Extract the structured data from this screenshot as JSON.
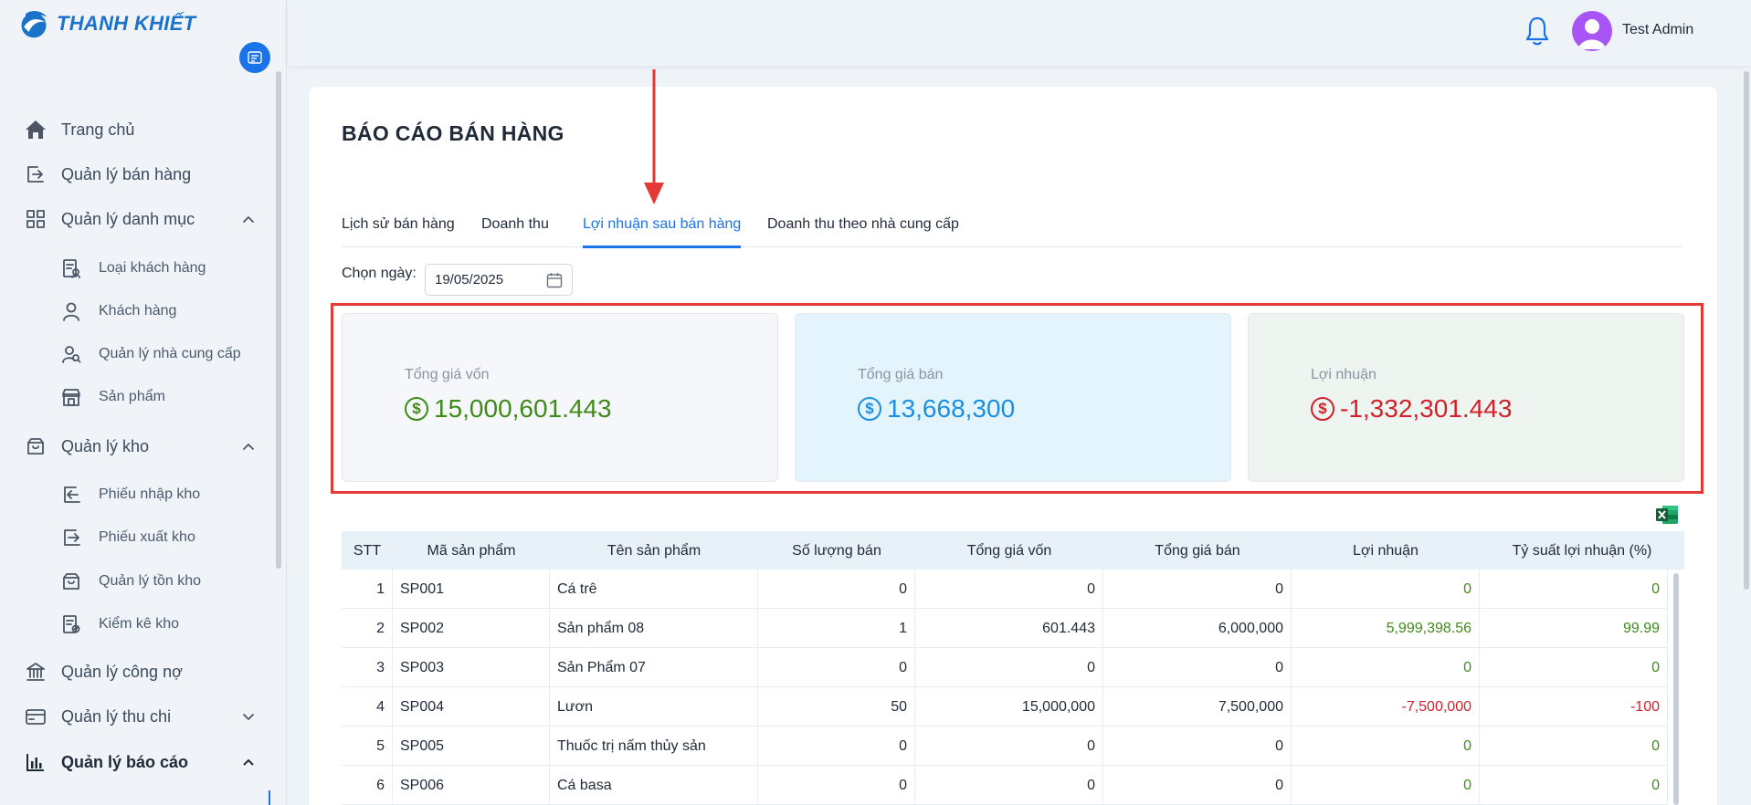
{
  "brand": {
    "name": "THANH KHIẾT"
  },
  "sidebar": {
    "items": [
      {
        "key": "home",
        "label": "Trang chủ",
        "icon": "home-icon"
      },
      {
        "key": "sales",
        "label": "Quản lý bán hàng",
        "icon": "sales-icon"
      },
      {
        "key": "catalog",
        "label": "Quản lý danh mục",
        "icon": "grid-icon",
        "expanded": true
      },
      {
        "key": "customer-types",
        "label": "Loại khách hàng",
        "icon": "customer-type-icon",
        "sub": true
      },
      {
        "key": "customers",
        "label": "Khách hàng",
        "icon": "user-icon",
        "sub": true
      },
      {
        "key": "suppliers",
        "label": "Quản lý nhà cung cấp",
        "icon": "supplier-icon",
        "sub": true
      },
      {
        "key": "products",
        "label": "Sản phẩm",
        "icon": "store-icon",
        "sub": true
      },
      {
        "key": "warehouse",
        "label": "Quản lý kho",
        "icon": "box-icon",
        "expanded": true
      },
      {
        "key": "stock-in",
        "label": "Phiếu nhập kho",
        "icon": "stock-in-icon",
        "sub": true
      },
      {
        "key": "stock-out",
        "label": "Phiếu xuất kho",
        "icon": "stock-out-icon",
        "sub": true
      },
      {
        "key": "inventory",
        "label": "Quản lý tồn kho",
        "icon": "inventory-icon",
        "sub": true
      },
      {
        "key": "stocktake",
        "label": "Kiểm kê kho",
        "icon": "stocktake-icon",
        "sub": true
      },
      {
        "key": "debt",
        "label": "Quản lý công nợ",
        "icon": "bank-icon"
      },
      {
        "key": "cashflow",
        "label": "Quản lý thu chi",
        "icon": "wallet-icon",
        "expanded": false
      },
      {
        "key": "reports",
        "label": "Quản lý báo cáo",
        "icon": "chart-icon",
        "expanded": true
      }
    ]
  },
  "header": {
    "username": "Test Admin"
  },
  "page": {
    "title": "BÁO CÁO BÁN HÀNG",
    "tabs": [
      {
        "label": "Lịch sử bán hàng",
        "active": false
      },
      {
        "label": "Doanh thu",
        "active": false
      },
      {
        "label": "Lợi nhuận sau bán hàng",
        "active": true
      },
      {
        "label": "Doanh thu theo nhà cung cấp",
        "active": false
      }
    ],
    "date_label": "Chọn ngày:",
    "date_value": "19/05/2025"
  },
  "stats": [
    {
      "label": "Tổng giá vốn",
      "value": "15,000,601.443",
      "color": "#3f8b1a"
    },
    {
      "label": "Tổng giá bán",
      "value": "13,668,300",
      "color": "#1a8fe3"
    },
    {
      "label": "Lợi nhuận",
      "value": "-1,332,301.443",
      "color": "#d4202b"
    }
  ],
  "table": {
    "columns": [
      "STT",
      "Mã sản phẩm",
      "Tên sản phẩm",
      "Số lượng bán",
      "Tổng giá vốn",
      "Tổng giá bán",
      "Lợi nhuận",
      "Tỷ suất lợi nhuận (%)"
    ],
    "rows": [
      [
        "1",
        "SP001",
        "Cá trê",
        "0",
        "0",
        "0",
        "0",
        "0"
      ],
      [
        "2",
        "SP002",
        "Sản phẩm 08",
        "1",
        "601.443",
        "6,000,000",
        "5,999,398.56",
        "99.99"
      ],
      [
        "3",
        "SP003",
        "Sản Phẩm 07",
        "0",
        "0",
        "0",
        "0",
        "0"
      ],
      [
        "4",
        "SP004",
        "Lươn",
        "50",
        "15,000,000",
        "7,500,000",
        "-7,500,000",
        "-100"
      ],
      [
        "5",
        "SP005",
        "Thuốc trị nấm thủy sản",
        "0",
        "0",
        "0",
        "0",
        "0"
      ],
      [
        "6",
        "SP006",
        "Cá basa",
        "0",
        "0",
        "0",
        "0",
        "0"
      ]
    ]
  },
  "colors": {
    "accent": "#1a73e8",
    "positive": "#3f8b1a",
    "negative": "#d4202b",
    "annotation": "#e53935"
  }
}
